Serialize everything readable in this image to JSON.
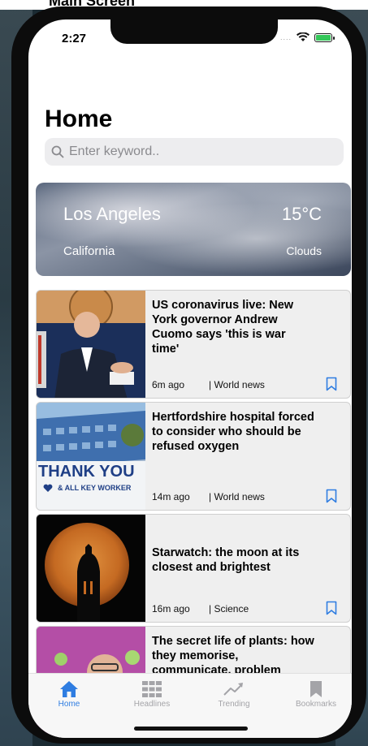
{
  "caption": "Main Screen",
  "status": {
    "time": "2:27",
    "signal": "....",
    "wifi_icon": "wifi-icon",
    "battery_icon": "battery-charging-icon"
  },
  "header": {
    "title": "Home"
  },
  "search": {
    "placeholder": "Enter keyword..",
    "icon": "search-icon"
  },
  "weather": {
    "city": "Los Angeles",
    "temperature": "15°C",
    "state": "California",
    "condition": "Clouds"
  },
  "articles": [
    {
      "title": "US coronavirus live: New York governor Andrew Cuomo says 'this is war time'",
      "time": "6m ago",
      "category": "| World news"
    },
    {
      "title": "Hertfordshire hospital forced to consider who should be refused oxygen",
      "time": "14m ago",
      "category": "| World news",
      "thumb_text_1": "THANK YOU",
      "thumb_text_2": "& ALL KEY WORKER"
    },
    {
      "title": "Starwatch: the moon at its closest and brightest",
      "time": "16m ago",
      "category": "| Science"
    },
    {
      "title": "The secret life of plants: how they memorise, communicate, problem",
      "time": "",
      "category": ""
    }
  ],
  "tabs": [
    {
      "label": "Home",
      "icon": "house-icon",
      "active": true
    },
    {
      "label": "Headlines",
      "icon": "grid-icon",
      "active": false
    },
    {
      "label": "Trending",
      "icon": "trending-icon",
      "active": false
    },
    {
      "label": "Bookmarks",
      "icon": "bookmark-icon",
      "active": false
    }
  ],
  "colors": {
    "accent": "#2f7de1",
    "card_bg": "#efefef",
    "search_bg": "#ededef"
  }
}
